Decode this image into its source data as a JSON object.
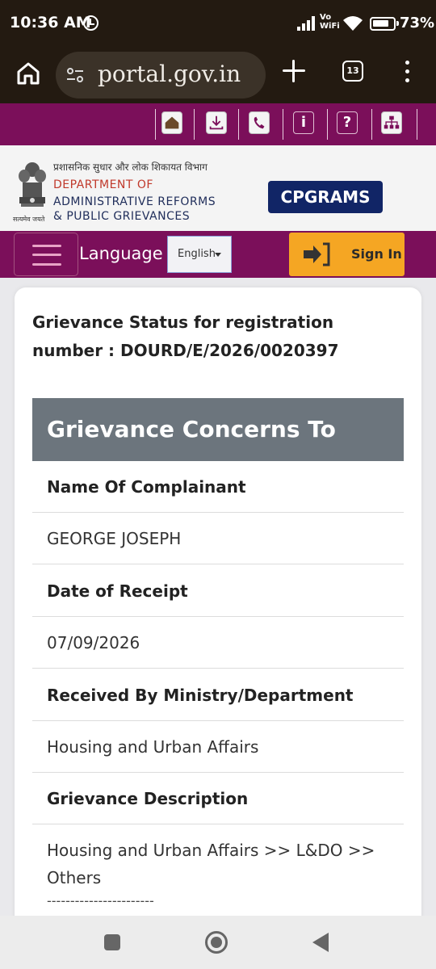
{
  "status_bar": {
    "time": "10:36 AM",
    "vowifi_line1": "Vo",
    "vowifi_line2": "WiFi",
    "battery": "73%",
    "icons": [
      "alarm-icon",
      "signal-icon",
      "wifi-icon",
      "battery-icon"
    ]
  },
  "browser": {
    "url": "portal.gov.in",
    "tab_count": "13",
    "icons": [
      "home-icon",
      "site-settings-icon",
      "plus-icon",
      "tabs-icon",
      "menu-icon"
    ]
  },
  "icon_strip": {
    "icons": [
      "home-icon",
      "download-icon",
      "phone-icon",
      "info-icon",
      "help-icon",
      "sitemap-icon"
    ],
    "info_glyph": "i",
    "help_glyph": "?"
  },
  "header": {
    "hindi_title": "प्रशासनिक सुधार और लोक शिकायत विभाग",
    "dept_line1": "DEPARTMENT OF",
    "dept_line2": "ADMINISTRATIVE REFORMS",
    "dept_line3": "& PUBLIC GRIEVANCES",
    "emblem_motto": "सत्यमेव जयते",
    "badge": "CPGRAMS"
  },
  "nav": {
    "language_label": "Language :",
    "language_selected": "English",
    "signin_label": "Sign In"
  },
  "grievance": {
    "heading": "Grievance Status for registration number : DOURD/E/2026/0020397",
    "section_title": "Grievance Concerns To",
    "complainant_label": "Name Of Complainant",
    "complainant_value": "GEORGE JOSEPH",
    "receipt_label": "Date of Receipt",
    "receipt_value": "07/09/2026",
    "ministry_label": "Received By Ministry/Department",
    "ministry_value": "Housing and Urban Affairs",
    "description_label": "Grievance Description",
    "description_value": "Housing and Urban Affairs >> L&DO >> Others",
    "description_divider": "-----------------------"
  },
  "colors": {
    "purple": "#7b0f5a",
    "navy": "#112566",
    "signin_orange": "#f5a623",
    "section_gray": "#6c757d"
  }
}
